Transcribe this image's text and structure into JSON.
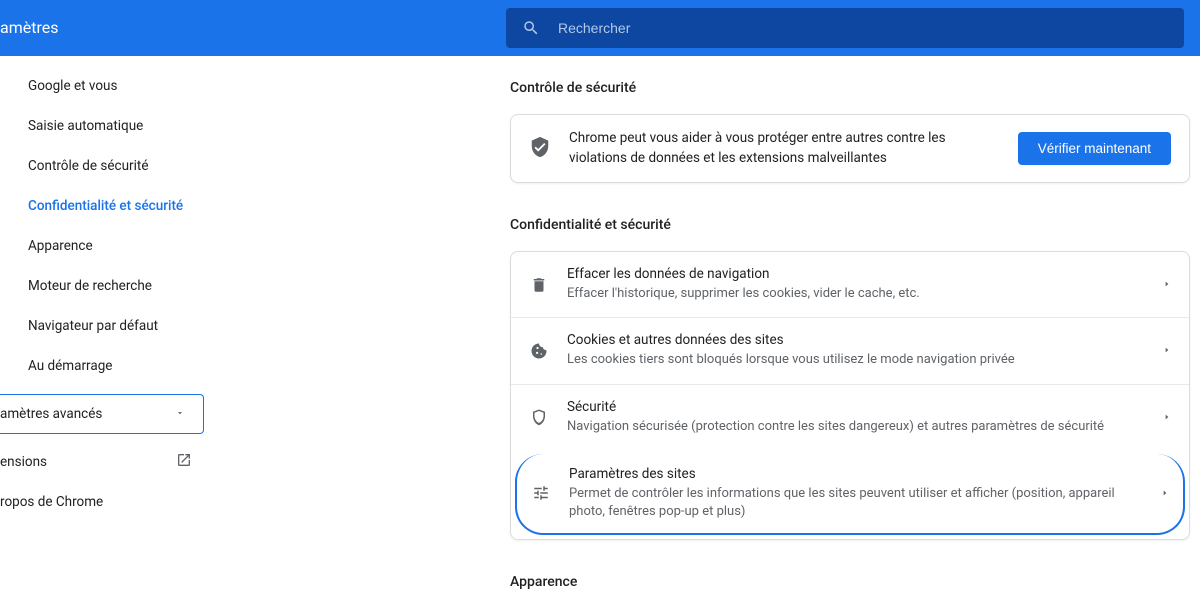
{
  "header": {
    "title": "amètres"
  },
  "search": {
    "placeholder": "Rechercher"
  },
  "sidebar": {
    "items": [
      {
        "label": "Google et vous"
      },
      {
        "label": "Saisie automatique"
      },
      {
        "label": "Contrôle de sécurité"
      },
      {
        "label": "Confidentialité et sécurité"
      },
      {
        "label": "Apparence"
      },
      {
        "label": "Moteur de recherche"
      },
      {
        "label": "Navigateur par défaut"
      },
      {
        "label": "Au démarrage"
      }
    ],
    "advanced": "amètres avancés",
    "extensions": "ensions",
    "about": "ropos de Chrome"
  },
  "main": {
    "safety": {
      "heading": "Contrôle de sécurité",
      "desc": "Chrome peut vous aider à vous protéger entre autres contre les violations de données et les extensions malveillantes",
      "button": "Vérifier maintenant"
    },
    "privacy": {
      "heading": "Confidentialité et sécurité",
      "rows": [
        {
          "title": "Effacer les données de navigation",
          "sub": "Effacer l'historique, supprimer les cookies, vider le cache, etc."
        },
        {
          "title": "Cookies et autres données des sites",
          "sub": "Les cookies tiers sont bloqués lorsque vous utilisez le mode navigation privée"
        },
        {
          "title": "Sécurité",
          "sub": "Navigation sécurisée (protection contre les sites dangereux) et autres paramètres de sécurité"
        },
        {
          "title": "Paramètres des sites",
          "sub": "Permet de contrôler les informations que les sites peuvent utiliser et afficher (position, appareil photo, fenêtres pop-up et plus)"
        }
      ]
    },
    "appearance": {
      "heading": "Apparence"
    }
  }
}
